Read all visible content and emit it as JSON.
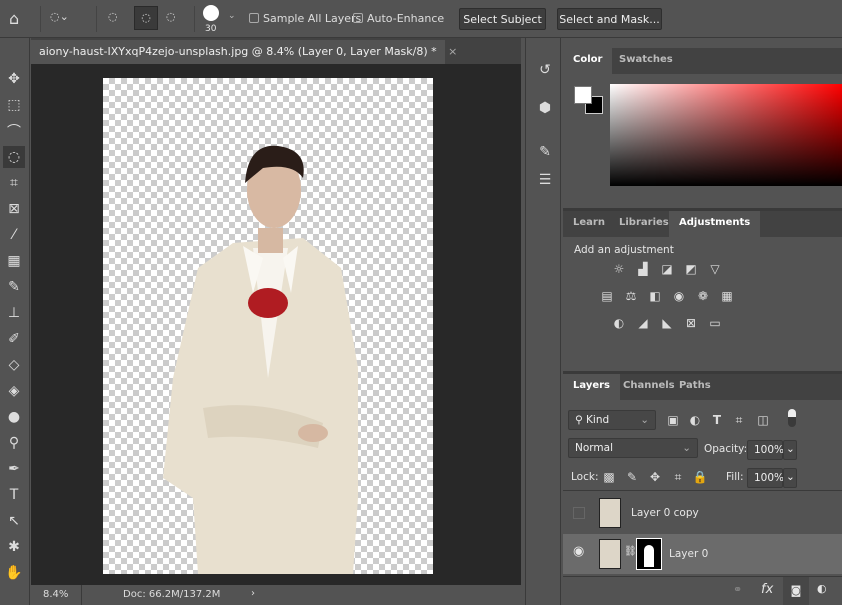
{
  "options_bar": {
    "brush_size": "30",
    "sample_all_layers": "Sample All Layers",
    "auto_enhance": "Auto-Enhance",
    "select_subject": "Select Subject",
    "select_and_mask": "Select and Mask..."
  },
  "document": {
    "tab_title": "aiony-haust-IXYxqP4zejo-unsplash.jpg @ 8.4% (Layer 0, Layer Mask/8) *",
    "close": "×"
  },
  "status": {
    "zoom": "8.4%",
    "doc": "Doc: 66.2M/137.2M",
    "arrow": "›"
  },
  "color_panel": {
    "tabs": [
      "Color",
      "Swatches"
    ],
    "hue": "#ff0000"
  },
  "adjust_panel": {
    "tabs": [
      "Learn",
      "Libraries",
      "Adjustments"
    ],
    "hint": "Add an adjustment"
  },
  "layers_panel": {
    "tabs": [
      "Layers",
      "Channels",
      "Paths"
    ],
    "filter": "Kind",
    "blend_mode": "Normal",
    "opacity_label": "Opacity:",
    "opacity": "100%",
    "lock_label": "Lock:",
    "fill_label": "Fill:",
    "fill": "100%",
    "layers": [
      {
        "name": "Layer 0 copy",
        "visible": false
      },
      {
        "name": "Layer 0",
        "visible": true,
        "selected": true
      }
    ]
  }
}
